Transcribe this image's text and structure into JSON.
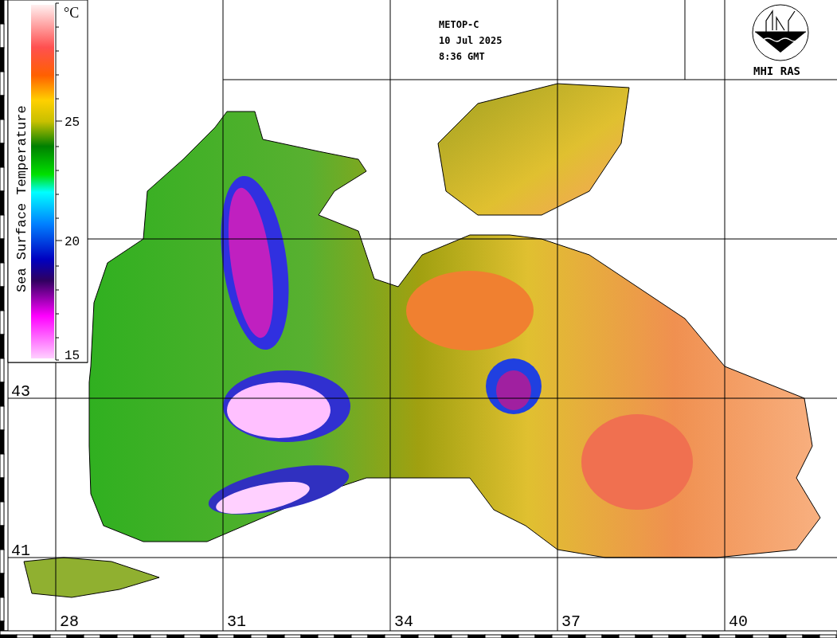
{
  "header": {
    "lines": [
      "METOP-C",
      "10 Jul 2025",
      "8:36 GMT"
    ]
  },
  "logo": {
    "text": "MHI RAS"
  },
  "colorbar": {
    "title": "Sea Surface Temperature",
    "unit": "°C",
    "ticks": [
      "25",
      "20",
      "15"
    ]
  },
  "map": {
    "latitude_labels": [
      "43",
      "41"
    ],
    "longitude_labels": [
      "28",
      "31",
      "34",
      "37",
      "40"
    ]
  }
}
